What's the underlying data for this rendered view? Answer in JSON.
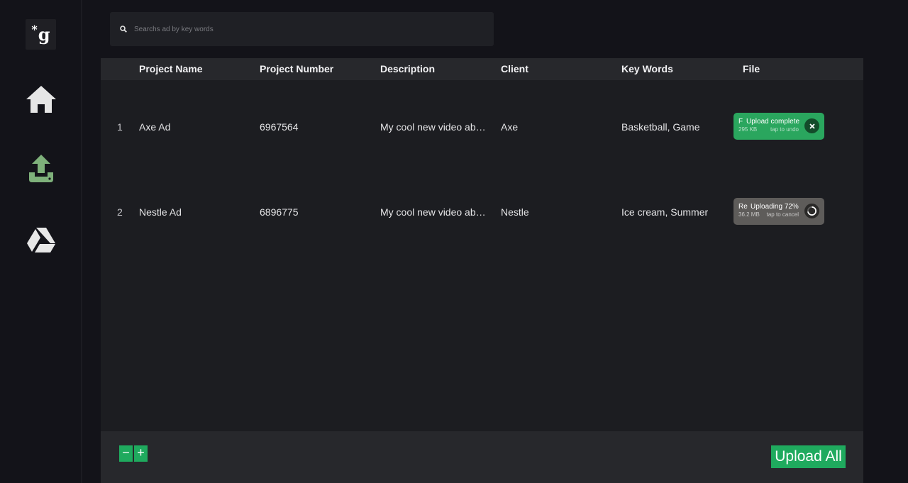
{
  "brand": {
    "logo_text": "g",
    "logo_mark": "*"
  },
  "sidebar": {
    "items": [
      {
        "icon": "home-icon",
        "color": "#e6e6e6"
      },
      {
        "icon": "upload-icon",
        "color": "#7eb07a"
      },
      {
        "icon": "google-drive-icon",
        "color": "#e6e6e6"
      }
    ]
  },
  "search": {
    "placeholder": "Searchs ad by key words",
    "value": ""
  },
  "table": {
    "headers": [
      "Project Name",
      "Project Number",
      "Description",
      "Client",
      "Key Words",
      "File"
    ],
    "rows": [
      {
        "index": "1",
        "name": "Axe Ad",
        "number": "6967564",
        "description": "My cool new video about...",
        "client": "Axe",
        "keywords": "Basketball, Game",
        "file": {
          "state": "complete",
          "stub": "F",
          "status": "Upload complete",
          "size": "295 KB",
          "hint": "tap to undo",
          "color": "#2aa65e"
        }
      },
      {
        "index": "2",
        "name": "Nestle Ad",
        "number": "6896775",
        "description": "My cool new video about...",
        "client": "Nestle",
        "keywords": "Ice cream, Summer",
        "file": {
          "state": "uploading",
          "stub": "Re",
          "status": "Uploading 72%",
          "progress": 0.72,
          "size": "36.2 MB",
          "hint": "tap to cancel",
          "color": "#5e5c5a"
        }
      }
    ]
  },
  "footer": {
    "remove_row_label": "−",
    "add_row_label": "+",
    "upload_all_label": "Upload All"
  },
  "colors": {
    "accent": "#1faa5e",
    "background": "#131319",
    "panel": "#1c1d21",
    "header": "#27282c"
  }
}
